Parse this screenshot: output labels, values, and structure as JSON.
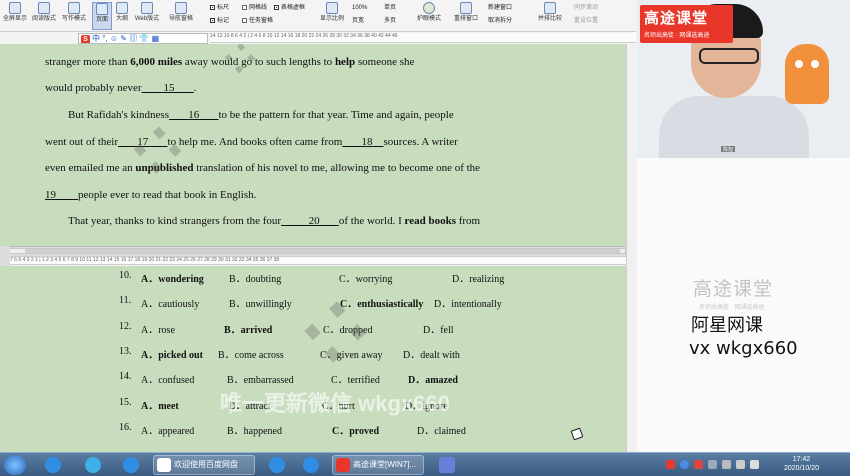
{
  "ribbon": {
    "buttons": [
      {
        "label": "全屏显示",
        "selected": false
      },
      {
        "label": "阅读版式",
        "selected": false
      },
      {
        "label": "写作模式",
        "selected": false
      },
      {
        "label": "页面",
        "selected": true
      },
      {
        "label": "大纲",
        "selected": false
      },
      {
        "label": "Web版式",
        "selected": false
      },
      {
        "label": "导航窗格",
        "selected": false
      }
    ],
    "checks": [
      {
        "label": "标尺",
        "checked": true
      },
      {
        "label": "网格线",
        "checked": false
      },
      {
        "label": "表格虚框",
        "checked": true
      },
      {
        "label": "标记",
        "checked": true
      },
      {
        "label": "任务窗格",
        "checked": false
      }
    ],
    "zoom_buttons": [
      {
        "label": "显示比例"
      },
      {
        "label": "100%"
      },
      {
        "label": "页宽"
      },
      {
        "label": "单页"
      },
      {
        "label": "多页"
      }
    ],
    "eye_mode": "护眼模式",
    "window_buttons": [
      {
        "label": "重排窗口"
      },
      {
        "label": "新建窗口"
      },
      {
        "label": "取消拆分"
      },
      {
        "label": "并排比较"
      },
      {
        "label": "同步滚动"
      },
      {
        "label": "重设位置"
      }
    ]
  },
  "toolbar2": {
    "text": "中 °, ☺ ✎ ▥ 👕 ▦"
  },
  "ruler": {
    "top": "14 12 10 8 6 4 2 | 2 4 6 8 10 12 14 16 18 20 22 24 26 28 30 32 34 36 38 40 42 44 46",
    "bottom": "7 6 5 4 3 2 1 | 1 2 3 4 5 6 7 8 9 10 11 12 13 14 15 16 17 18 19 20 21 22 23 24 25 26 27 28 29 30 31 32 33 34 35 36 37 38"
  },
  "passage": {
    "l1a": "stranger more than ",
    "l1b": "6,000 miles",
    "l1c": " away would go to such lengths to ",
    "l1d": "help",
    "l1e": " someone she",
    "l2a": "would probably never",
    "l2b": "15",
    "l3a": "But Rafidah's kindness",
    "l3b": "16",
    "l3c": "to be the pattern for that year. Time and again, people",
    "l4a": "went out of their",
    "l4b": "17",
    "l4c": "to help me. And books often came from",
    "l4d": "18",
    "l4e": "sources. A writer",
    "l5a": "even emailed me an ",
    "l5b": "unpublished",
    "l5c": " translation of his novel to me, allowing me to become one of the",
    "l6a": "19",
    "l6b": "people ever to read that book in English.",
    "l7a": "That year, thanks to kind strangers from the four",
    "l7b": "20",
    "l7c": "of the world. I ",
    "l7d": "read books",
    "l7e": " from"
  },
  "options": [
    {
      "num": "10.",
      "a": "A．wondering",
      "b": "B．doubting",
      "c": "C．worrying",
      "d": "D．realizing",
      "bold": "a"
    },
    {
      "num": "11.",
      "a": "A．cautiously",
      "b": "B．unwillingly",
      "c": "C．enthusiastically",
      "d": "D．intentionally",
      "bold": "c"
    },
    {
      "num": "12.",
      "a": "A．rose",
      "b": "B．arrived",
      "c": "C．dropped",
      "d": "D．fell",
      "bold": "b"
    },
    {
      "num": "13.",
      "a": "A．picked out",
      "b": "B．come across",
      "c": "C．given away",
      "d": "D．dealt with",
      "bold": "a"
    },
    {
      "num": "14.",
      "a": "A．confused",
      "b": "B．embarrassed",
      "c": "C．terrified",
      "d": "D．amazed",
      "bold": "d"
    },
    {
      "num": "15.",
      "a": "A．meet",
      "b": "B．attract",
      "c": "C．hurt",
      "d": "D．ignore",
      "bold": "a"
    },
    {
      "num": "16.",
      "a": "A．appeared",
      "b": "B．happened",
      "c": "C．proved",
      "d": "D．claimed",
      "bold": "c"
    }
  ],
  "watermark": {
    "bottom": "唯一更新微信 wkgx660"
  },
  "video": {
    "logo": "高途课堂",
    "logo_sub": "名师出高徒 · 网课选高途",
    "name_tag": "陈旭"
  },
  "side": {
    "logo": "高途课堂",
    "logo_sub": "名师出高徒 · 网课选高途",
    "ad_line1": "阿星网课",
    "ad_line2": "vx  wkgx660"
  },
  "taskbar": {
    "items": [
      {
        "label": "欢迎使用百度网盘"
      },
      {
        "label": "高途课堂[WIN7]..."
      }
    ],
    "clock_time": "17:42",
    "clock_date": "2020/10/20"
  },
  "colors": {
    "eye_green": "#c8dcbe",
    "brand_red": "#e8372a",
    "taskbar": "#3a5a80"
  }
}
